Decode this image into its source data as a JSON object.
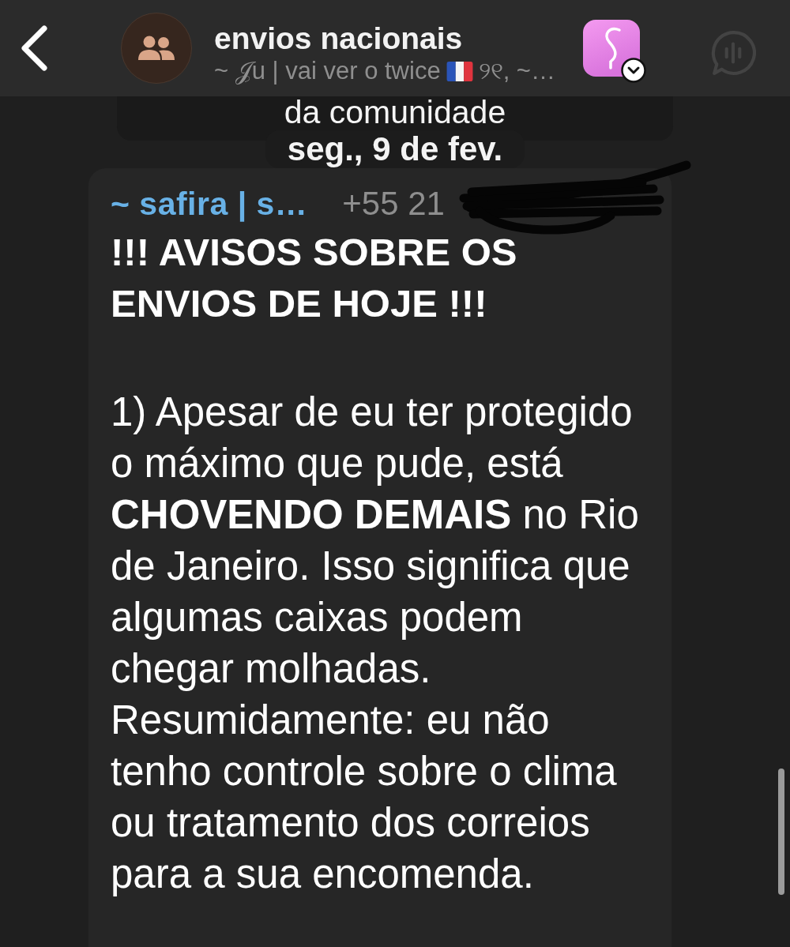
{
  "header": {
    "title": "envios nacionais",
    "subtitle": [
      {
        "kind": "text",
        "text": "~ 𝒥u | vai ver o twice"
      },
      {
        "kind": "flag"
      },
      {
        "kind": "text",
        "text": "୨୧, ~…"
      }
    ]
  },
  "pinned_card": {
    "text": "da comunidade"
  },
  "date_separator": "seg., 9 de fev.",
  "message": {
    "sender": "~ safira | s…",
    "phone": "+55 21",
    "phone_redacted": true,
    "heading": "!!! AVISOS SOBRE OS ENVIOS DE HOJE !!!",
    "body": "1) Apesar de eu ter protegido o máximo que pude, está **CHOVENDO DEMAIS** no Rio de Janeiro. Isso significa que algumas caixas podem chegar molhadas. Resumidamente: eu não tenho controle sobre o clima ou tratamento dos correios para a sua encomenda."
  }
}
